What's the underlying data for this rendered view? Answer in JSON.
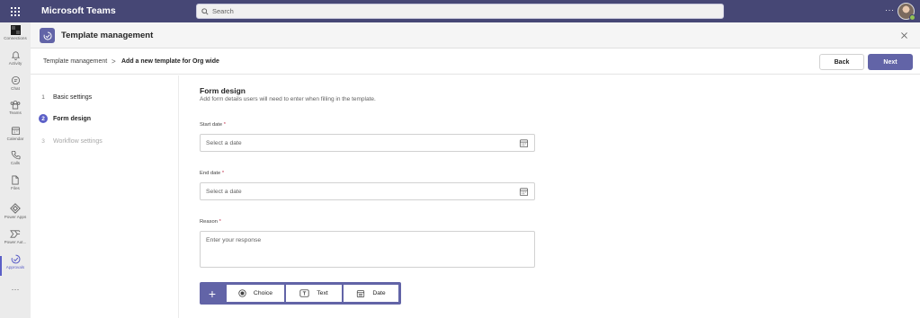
{
  "app": {
    "name": "Microsoft Teams"
  },
  "search": {
    "placeholder": "Search"
  },
  "header": {
    "more_label": "···"
  },
  "rail": {
    "items": [
      {
        "label": "Connections",
        "icon": "connections-icon"
      },
      {
        "label": "Activity",
        "icon": "bell-icon"
      },
      {
        "label": "Chat",
        "icon": "chat-icon"
      },
      {
        "label": "Teams",
        "icon": "teams-icon"
      },
      {
        "label": "Calendar",
        "icon": "calendar-icon"
      },
      {
        "label": "Calls",
        "icon": "phone-icon"
      },
      {
        "label": "Files",
        "icon": "file-icon"
      },
      {
        "label": "Power Apps",
        "icon": "power-apps-icon"
      },
      {
        "label": "Power Aut...",
        "icon": "power-automate-icon"
      },
      {
        "label": "Approvals",
        "icon": "approvals-icon",
        "active": true
      }
    ],
    "more_label": "···"
  },
  "app_header": {
    "title": "Template management"
  },
  "breadcrumb": {
    "items": [
      "Template management",
      "Add a new template for Org wide"
    ],
    "separator": ">"
  },
  "actions": {
    "back_label": "Back",
    "next_label": "Next"
  },
  "steps": [
    {
      "number": "1",
      "label": "Basic settings",
      "state": "done"
    },
    {
      "number": "2",
      "label": "Form design",
      "state": "active"
    },
    {
      "number": "3",
      "label": "Workflow settings",
      "state": "disabled"
    }
  ],
  "form": {
    "title": "Form design",
    "subtitle": "Add form details users will need to enter when filling in the template.",
    "fields": [
      {
        "label": "Start date",
        "required_mark": "*",
        "placeholder": "Select a date",
        "type": "date"
      },
      {
        "label": "End date",
        "required_mark": "*",
        "placeholder": "Select a date",
        "type": "date"
      },
      {
        "label": "Reason",
        "required_mark": "*",
        "placeholder": "Enter your response",
        "type": "text"
      }
    ]
  },
  "add_toolbar": {
    "plus_label": "+",
    "buttons": [
      {
        "label": "Choice",
        "icon": "radio-icon"
      },
      {
        "label": "Text",
        "icon": "text-box-icon"
      },
      {
        "label": "Date",
        "icon": "calendar-icon"
      }
    ]
  },
  "colors": {
    "brand": "#464775",
    "accent": "#6264a7",
    "active": "#5b5fc7",
    "required": "#c4314b"
  }
}
